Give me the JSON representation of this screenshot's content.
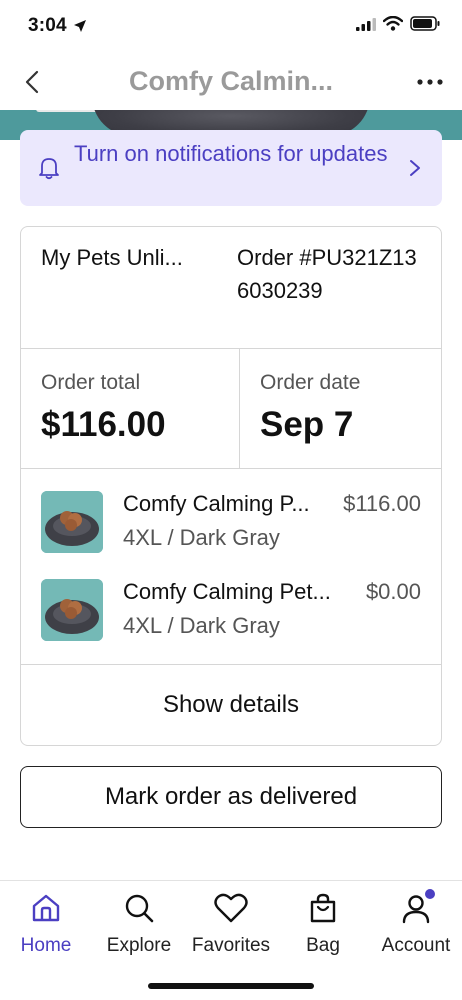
{
  "status_bar": {
    "time": "3:04"
  },
  "header": {
    "title": "Comfy Calmin..."
  },
  "notification": {
    "text": "Turn on notifications for updates"
  },
  "order": {
    "shop_name": "My Pets Unli...",
    "order_number": "Order #PU321Z136030239",
    "total_label": "Order total",
    "total_value": "$116.00",
    "date_label": "Order date",
    "date_value": "Sep 7",
    "items": [
      {
        "title": "Comfy Calming P...",
        "price": "$116.00",
        "variant": "4XL / Dark Gray"
      },
      {
        "title": "Comfy Calming Pet...",
        "price": "$0.00",
        "variant": "4XL / Dark Gray"
      }
    ],
    "show_details_label": "Show details"
  },
  "actions": {
    "mark_delivered_label": "Mark order as delivered"
  },
  "tab_bar": {
    "tabs": [
      {
        "label": "Home",
        "icon": "home-icon",
        "active": true
      },
      {
        "label": "Explore",
        "icon": "search-icon"
      },
      {
        "label": "Favorites",
        "icon": "heart-icon"
      },
      {
        "label": "Bag",
        "icon": "bag-icon"
      },
      {
        "label": "Account",
        "icon": "account-icon"
      }
    ]
  },
  "colors": {
    "accent": "#4b3fc2",
    "banner_bg": "#ebe8fd",
    "teal": "#4e9a9c"
  }
}
